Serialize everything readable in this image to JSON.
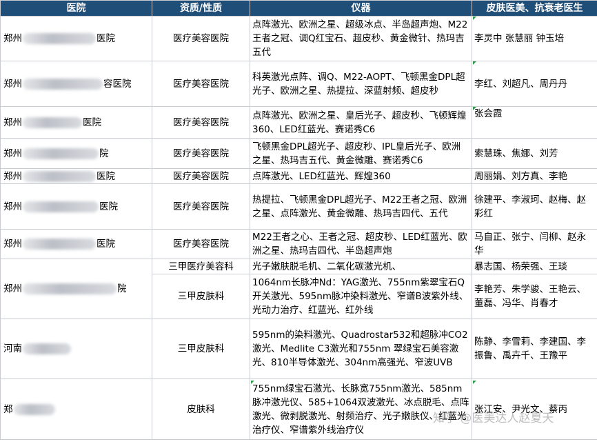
{
  "headers": [
    "医院",
    "资质/性质",
    "仪器",
    "皮肤医美、抗衰老医生"
  ],
  "rows": [
    {
      "hosp_pre": "郑州",
      "hosp_suf": "医院",
      "qual": "医疗美容医院",
      "inst": "点阵激光、欧洲之星、超级冰点、半岛超声炮、M22王者之冠、调Q红宝石、超皮秒、黄金微针、热玛吉五代",
      "doc": "李灵中 张慧丽 钟玉培"
    },
    {
      "hosp_pre": "郑州",
      "hosp_suf": "容医院",
      "qual": "医疗美容医院",
      "inst": "科英激光点阵、调Q、M22-AOPT、飞顿黑金DPL超光子、欧洲之星、热提拉、深蓝射频、超皮秒",
      "doc": "李红、刘超凡、周丹丹"
    },
    {
      "hosp_pre": "郑州",
      "hosp_suf": "医院",
      "qual": "医疗美容医院",
      "inst": "点阵激光、欧洲之星、皇后光子、超皮秒、飞顿辉煌360、LED红蓝光、赛诺秀C6",
      "doc": "张会霞"
    },
    {
      "hosp_pre": "郑州",
      "hosp_suf": "院",
      "qual": "医疗美容医院",
      "inst": "飞顿黑金DPL超光子、超皮秒、IPL皇后光子、欧洲之星、热玛吉五代、黄金微雕、赛诺秀C6",
      "doc": "索慧珠、焦娜、刘芳"
    },
    {
      "hosp_pre": "郑州",
      "hosp_suf": "医院",
      "qual": "医疗美容医院",
      "inst": "点阵激光、LED红蓝光、辉煌360",
      "doc": "周丽娟、刘方真、李艳"
    },
    {
      "hosp_pre": "郑州",
      "hosp_suf": "医院",
      "qual": "医疗美容医院",
      "inst": "热提拉、飞顿黑金DPL超光子、M22王者之冠、欧洲之星、点阵激光、黄金微雕、热玛吉四代、五代",
      "doc": "徐建平、李淑珂、赵梅、赵彩红"
    },
    {
      "hosp_pre": "郑州",
      "hosp_suf": "医院",
      "qual": "医疗美容医院",
      "inst": "M22王者之心、王者之冠、超皮秒、LED红蓝光、欧洲之星、热玛吉四代、半岛超声炮",
      "doc": "马自正、张宁、闫柳、赵永华"
    },
    {
      "hosp_pre": "郑州",
      "hosp_suf": "院",
      "qual": "三甲医疗美容科",
      "inst": "光子嫩肤脱毛机、二氧化碳激光机、",
      "doc": "暴志国、杨荣强、王琰"
    },
    {
      "qual": "三甲皮肤科",
      "inst": "1064nm长脉冲Nd：YAG激光、755nm紫翠宝石Q开关激光、595nm脉冲染料激光、窄谱B波紫外线、光动力治疗、红蓝光、红外线",
      "doc": "李艳芳、朱学骏、王艳云、董磊、冯华、肖春才"
    },
    {
      "hosp_pre": "河南",
      "hosp_suf": "",
      "qual": "三甲皮肤科",
      "inst": "595nm的染料激光、Quadrostar532和超脉冲CO2激光、Medlite C3激光和755nm 翠绿宝石美容激光、810半导体激光、304nm高强光、窄波UVB",
      "doc": "陈静、李雪莉、李建国、李振鲁、禹卉千、王豫平"
    },
    {
      "hosp_pre": "郑",
      "hosp_suf": "",
      "qual": "皮肤科",
      "inst": "755nm绿宝石激光、长脉宽755nm激光、585nm脉冲激光仪、585+1064双波激光、冰点脱毛、点阵激光、微剥脱激光、射频治疗、光子嫩肤仪、红蓝光治疗仪、窄谱紫外线治疗仪",
      "doc": "张江安、尹光文、蔡丙"
    }
  ],
  "watermark": "知乎 @医美达人赵夏天",
  "colors": {
    "header_bg": "#1f4e79",
    "header_fg": "#ffffff",
    "grid": "#c9ccd0",
    "corner_mark": "#2e9e4a"
  }
}
